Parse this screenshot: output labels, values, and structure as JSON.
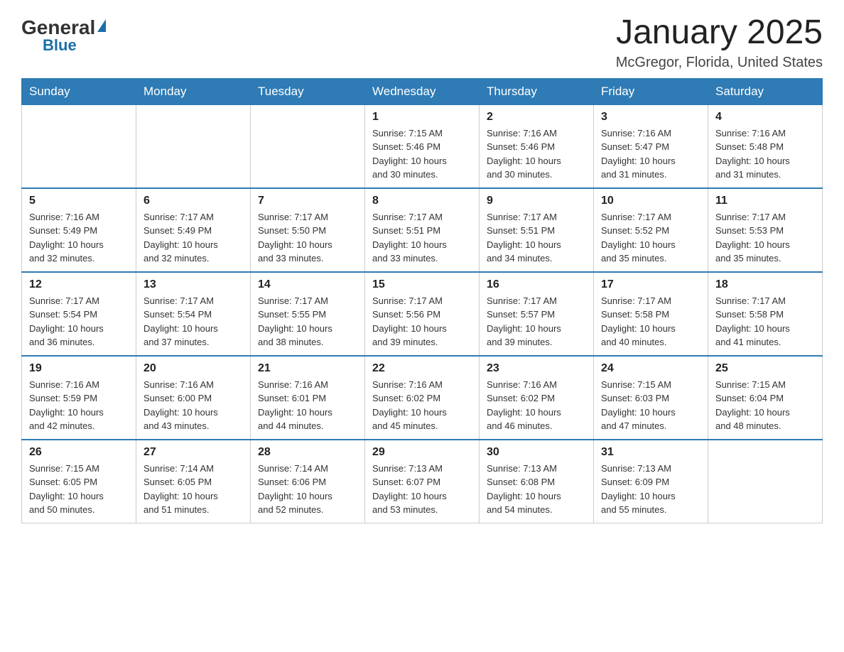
{
  "logo": {
    "general": "General",
    "blue": "Blue"
  },
  "title": "January 2025",
  "location": "McGregor, Florida, United States",
  "days_of_week": [
    "Sunday",
    "Monday",
    "Tuesday",
    "Wednesday",
    "Thursday",
    "Friday",
    "Saturday"
  ],
  "weeks": [
    [
      {
        "day": "",
        "info": ""
      },
      {
        "day": "",
        "info": ""
      },
      {
        "day": "",
        "info": ""
      },
      {
        "day": "1",
        "info": "Sunrise: 7:15 AM\nSunset: 5:46 PM\nDaylight: 10 hours\nand 30 minutes."
      },
      {
        "day": "2",
        "info": "Sunrise: 7:16 AM\nSunset: 5:46 PM\nDaylight: 10 hours\nand 30 minutes."
      },
      {
        "day": "3",
        "info": "Sunrise: 7:16 AM\nSunset: 5:47 PM\nDaylight: 10 hours\nand 31 minutes."
      },
      {
        "day": "4",
        "info": "Sunrise: 7:16 AM\nSunset: 5:48 PM\nDaylight: 10 hours\nand 31 minutes."
      }
    ],
    [
      {
        "day": "5",
        "info": "Sunrise: 7:16 AM\nSunset: 5:49 PM\nDaylight: 10 hours\nand 32 minutes."
      },
      {
        "day": "6",
        "info": "Sunrise: 7:17 AM\nSunset: 5:49 PM\nDaylight: 10 hours\nand 32 minutes."
      },
      {
        "day": "7",
        "info": "Sunrise: 7:17 AM\nSunset: 5:50 PM\nDaylight: 10 hours\nand 33 minutes."
      },
      {
        "day": "8",
        "info": "Sunrise: 7:17 AM\nSunset: 5:51 PM\nDaylight: 10 hours\nand 33 minutes."
      },
      {
        "day": "9",
        "info": "Sunrise: 7:17 AM\nSunset: 5:51 PM\nDaylight: 10 hours\nand 34 minutes."
      },
      {
        "day": "10",
        "info": "Sunrise: 7:17 AM\nSunset: 5:52 PM\nDaylight: 10 hours\nand 35 minutes."
      },
      {
        "day": "11",
        "info": "Sunrise: 7:17 AM\nSunset: 5:53 PM\nDaylight: 10 hours\nand 35 minutes."
      }
    ],
    [
      {
        "day": "12",
        "info": "Sunrise: 7:17 AM\nSunset: 5:54 PM\nDaylight: 10 hours\nand 36 minutes."
      },
      {
        "day": "13",
        "info": "Sunrise: 7:17 AM\nSunset: 5:54 PM\nDaylight: 10 hours\nand 37 minutes."
      },
      {
        "day": "14",
        "info": "Sunrise: 7:17 AM\nSunset: 5:55 PM\nDaylight: 10 hours\nand 38 minutes."
      },
      {
        "day": "15",
        "info": "Sunrise: 7:17 AM\nSunset: 5:56 PM\nDaylight: 10 hours\nand 39 minutes."
      },
      {
        "day": "16",
        "info": "Sunrise: 7:17 AM\nSunset: 5:57 PM\nDaylight: 10 hours\nand 39 minutes."
      },
      {
        "day": "17",
        "info": "Sunrise: 7:17 AM\nSunset: 5:58 PM\nDaylight: 10 hours\nand 40 minutes."
      },
      {
        "day": "18",
        "info": "Sunrise: 7:17 AM\nSunset: 5:58 PM\nDaylight: 10 hours\nand 41 minutes."
      }
    ],
    [
      {
        "day": "19",
        "info": "Sunrise: 7:16 AM\nSunset: 5:59 PM\nDaylight: 10 hours\nand 42 minutes."
      },
      {
        "day": "20",
        "info": "Sunrise: 7:16 AM\nSunset: 6:00 PM\nDaylight: 10 hours\nand 43 minutes."
      },
      {
        "day": "21",
        "info": "Sunrise: 7:16 AM\nSunset: 6:01 PM\nDaylight: 10 hours\nand 44 minutes."
      },
      {
        "day": "22",
        "info": "Sunrise: 7:16 AM\nSunset: 6:02 PM\nDaylight: 10 hours\nand 45 minutes."
      },
      {
        "day": "23",
        "info": "Sunrise: 7:16 AM\nSunset: 6:02 PM\nDaylight: 10 hours\nand 46 minutes."
      },
      {
        "day": "24",
        "info": "Sunrise: 7:15 AM\nSunset: 6:03 PM\nDaylight: 10 hours\nand 47 minutes."
      },
      {
        "day": "25",
        "info": "Sunrise: 7:15 AM\nSunset: 6:04 PM\nDaylight: 10 hours\nand 48 minutes."
      }
    ],
    [
      {
        "day": "26",
        "info": "Sunrise: 7:15 AM\nSunset: 6:05 PM\nDaylight: 10 hours\nand 50 minutes."
      },
      {
        "day": "27",
        "info": "Sunrise: 7:14 AM\nSunset: 6:05 PM\nDaylight: 10 hours\nand 51 minutes."
      },
      {
        "day": "28",
        "info": "Sunrise: 7:14 AM\nSunset: 6:06 PM\nDaylight: 10 hours\nand 52 minutes."
      },
      {
        "day": "29",
        "info": "Sunrise: 7:13 AM\nSunset: 6:07 PM\nDaylight: 10 hours\nand 53 minutes."
      },
      {
        "day": "30",
        "info": "Sunrise: 7:13 AM\nSunset: 6:08 PM\nDaylight: 10 hours\nand 54 minutes."
      },
      {
        "day": "31",
        "info": "Sunrise: 7:13 AM\nSunset: 6:09 PM\nDaylight: 10 hours\nand 55 minutes."
      },
      {
        "day": "",
        "info": ""
      }
    ]
  ]
}
